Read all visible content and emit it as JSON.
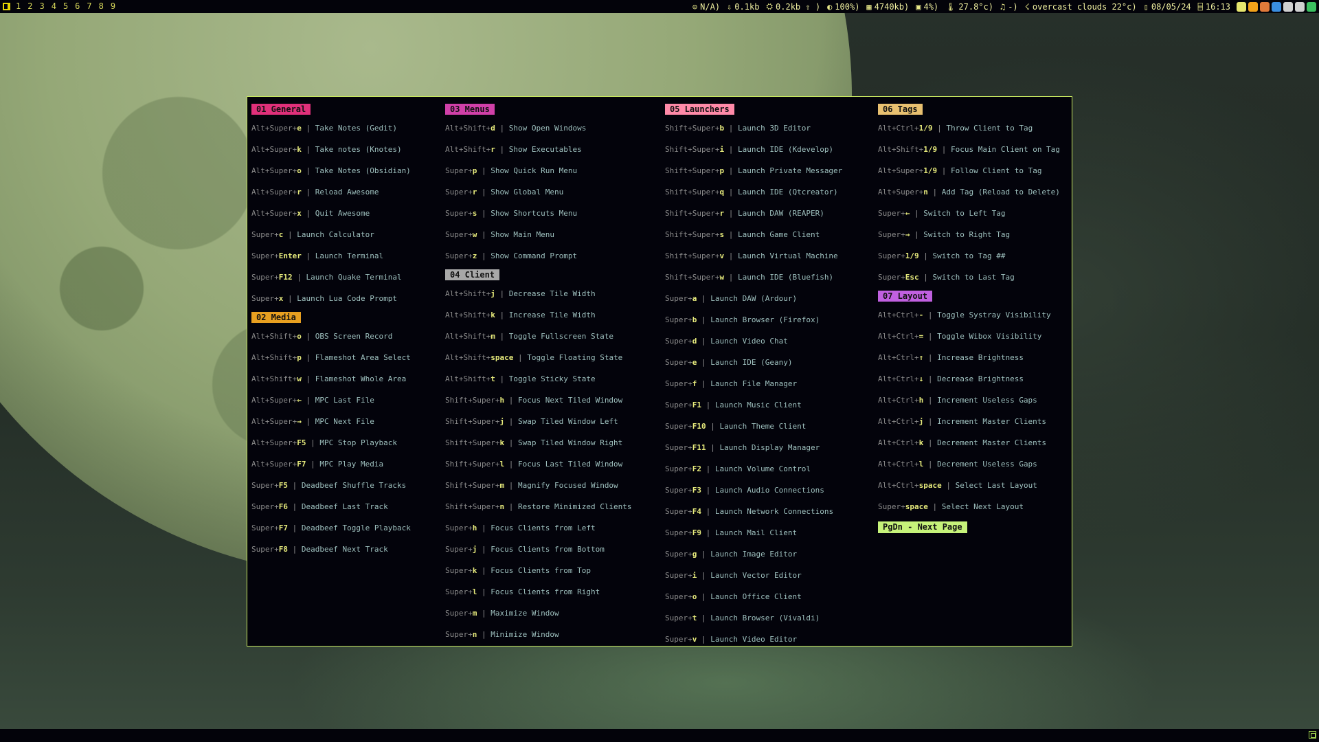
{
  "colors": {
    "bar_bg": "#03030a",
    "popup_bg": "#03030b",
    "popup_border": "#c8e860",
    "key": "#e6ea7c",
    "modifier": "#8b8b8b",
    "description": "#9ec0be",
    "general": "#e0307a",
    "media": "#e8a020",
    "menus": "#d040a8",
    "client": "#a8a8a8",
    "launchers": "#ff8aa8",
    "tags": "#e8c070",
    "layout": "#c060e0",
    "pgdn": "#c6f37a"
  },
  "topbar": {
    "tags": [
      {
        "label": "1",
        "icon": "terminal-icon"
      },
      {
        "label": "2",
        "icon": "browser-icon"
      },
      {
        "label": "3",
        "icon": "code-icon"
      },
      {
        "label": "4",
        "icon": "chat-icon"
      },
      {
        "label": "5",
        "icon": "music-icon"
      },
      {
        "label": "6",
        "icon": "folder-icon"
      },
      {
        "label": "7",
        "icon": "game-icon"
      },
      {
        "label": "8",
        "icon": "media-icon"
      },
      {
        "label": "9",
        "icon": "mail-icon"
      }
    ],
    "status": [
      {
        "icon": "vpn-icon",
        "glyph": "⊙",
        "text": "N/A)"
      },
      {
        "icon": "download-icon",
        "glyph": "⇩",
        "text": "0.1kb"
      },
      {
        "icon": "network-icon",
        "glyph": "⛭",
        "text": "0.2kb ⇧ )"
      },
      {
        "icon": "volume-icon",
        "glyph": "◐",
        "text": "100%)"
      },
      {
        "icon": "memory-icon",
        "glyph": "▦",
        "text": "4740kb)"
      },
      {
        "icon": "cpu-icon",
        "glyph": "▣",
        "text": "4%)"
      },
      {
        "icon": "temperature-icon",
        "glyph": "🌡",
        "text": "27.8°c)"
      },
      {
        "icon": "music-note-icon",
        "glyph": "♫",
        "text": "-)"
      },
      {
        "icon": "weather-icon",
        "glyph": "☇",
        "text": "overcast clouds 22°c)"
      },
      {
        "icon": "calendar-icon",
        "glyph": "▯",
        "text": "08/05/24"
      },
      {
        "icon": "clock-icon",
        "glyph": "⌸",
        "text": "16:13"
      }
    ],
    "tray": [
      {
        "icon": "tray-power-icon",
        "color": "#e6e66e"
      },
      {
        "icon": "tray-notes-icon",
        "color": "#f2a21a"
      },
      {
        "icon": "tray-app-icon",
        "color": "#e07a3a"
      },
      {
        "icon": "tray-telegram-icon",
        "color": "#3a8ee0"
      },
      {
        "icon": "tray-signal-icon",
        "color": "#d0d0d0"
      },
      {
        "icon": "tray-volume-icon",
        "color": "#d0d0d0"
      },
      {
        "icon": "tray-shield-icon",
        "color": "#3cc060"
      }
    ]
  },
  "popup": {
    "columns": [
      {
        "sections": [
          {
            "title": "01 General",
            "color": "#e0307a",
            "rows": [
              {
                "mod": "Alt+Super+",
                "key": "e",
                "desc": "Take Notes (Gedit)"
              },
              {
                "mod": "Alt+Super+",
                "key": "k",
                "desc": "Take notes (Knotes)"
              },
              {
                "mod": "Alt+Super+",
                "key": "o",
                "desc": "Take Notes (Obsidian)"
              },
              {
                "mod": "Alt+Super+",
                "key": "r",
                "desc": "Reload Awesome"
              },
              {
                "mod": "Alt+Super+",
                "key": "x",
                "desc": "Quit Awesome"
              },
              {
                "mod": "Super+",
                "key": "c",
                "desc": "Launch Calculator"
              },
              {
                "mod": "Super+",
                "key": "Enter",
                "desc": "Launch Terminal"
              },
              {
                "mod": "Super+",
                "key": "F12",
                "desc": "Launch Quake Terminal"
              },
              {
                "mod": "Super+",
                "key": "x",
                "desc": "Launch Lua Code Prompt"
              }
            ]
          },
          {
            "title": "02 Media",
            "color": "#e8a020",
            "rows": [
              {
                "mod": "Alt+Shift+",
                "key": "o",
                "desc": "OBS Screen Record"
              },
              {
                "mod": "Alt+Shift+",
                "key": "p",
                "desc": "Flameshot Area Select"
              },
              {
                "mod": "Alt+Shift+",
                "key": "w",
                "desc": "Flameshot Whole Area"
              },
              {
                "mod": "Alt+Super+",
                "key": "←",
                "desc": "MPC Last File"
              },
              {
                "mod": "Alt+Super+",
                "key": "→",
                "desc": "MPC Next File"
              },
              {
                "mod": "Alt+Super+",
                "key": "F5",
                "desc": "MPC Stop Playback"
              },
              {
                "mod": "Alt+Super+",
                "key": "F7",
                "desc": "MPC Play Media"
              },
              {
                "mod": "Super+",
                "key": "F5",
                "desc": "Deadbeef Shuffle Tracks"
              },
              {
                "mod": "Super+",
                "key": "F6",
                "desc": "Deadbeef Last Track"
              },
              {
                "mod": "Super+",
                "key": "F7",
                "desc": "Deadbeef Toggle Playback"
              },
              {
                "mod": "Super+",
                "key": "F8",
                "desc": "Deadbeef Next Track"
              }
            ]
          }
        ]
      },
      {
        "sections": [
          {
            "title": "03 Menus",
            "color": "#d040a8",
            "rows": [
              {
                "mod": "Alt+Shift+",
                "key": "d",
                "desc": "Show Open Windows"
              },
              {
                "mod": "Alt+Shift+",
                "key": "r",
                "desc": "Show Executables"
              },
              {
                "mod": "Super+",
                "key": "p",
                "desc": "Show Quick Run Menu"
              },
              {
                "mod": "Super+",
                "key": "r",
                "desc": "Show Global Menu"
              },
              {
                "mod": "Super+",
                "key": "s",
                "desc": "Show Shortcuts Menu"
              },
              {
                "mod": "Super+",
                "key": "w",
                "desc": "Show Main Menu"
              },
              {
                "mod": "Super+",
                "key": "z",
                "desc": "Show Command Prompt"
              }
            ]
          },
          {
            "title": "04 Client",
            "color": "#a8a8a8",
            "rows": [
              {
                "mod": "Alt+Shift+",
                "key": "j",
                "desc": "Decrease Tile Width"
              },
              {
                "mod": "Alt+Shift+",
                "key": "k",
                "desc": "Increase Tile Width"
              },
              {
                "mod": "Alt+Shift+",
                "key": "m",
                "desc": "Toggle Fullscreen State"
              },
              {
                "mod": "Alt+Shift+",
                "key": "space",
                "desc": "Toggle Floating State"
              },
              {
                "mod": "Alt+Shift+",
                "key": "t",
                "desc": "Toggle Sticky State"
              },
              {
                "mod": "Shift+Super+",
                "key": "h",
                "desc": "Focus Next Tiled Window"
              },
              {
                "mod": "Shift+Super+",
                "key": "j",
                "desc": "Swap Tiled Window Left"
              },
              {
                "mod": "Shift+Super+",
                "key": "k",
                "desc": "Swap Tiled Window Right"
              },
              {
                "mod": "Shift+Super+",
                "key": "l",
                "desc": "Focus Last Tiled Window"
              },
              {
                "mod": "Shift+Super+",
                "key": "m",
                "desc": "Magnify Focused Window"
              },
              {
                "mod": "Shift+Super+",
                "key": "n",
                "desc": "Restore Minimized Clients"
              },
              {
                "mod": "Super+",
                "key": "h",
                "desc": "Focus Clients from Left"
              },
              {
                "mod": "Super+",
                "key": "j",
                "desc": "Focus Clients from Bottom"
              },
              {
                "mod": "Super+",
                "key": "k",
                "desc": "Focus Clients from Top"
              },
              {
                "mod": "Super+",
                "key": "l",
                "desc": "Focus Clients from Right"
              },
              {
                "mod": "Super+",
                "key": "m",
                "desc": "Maximize Window"
              },
              {
                "mod": "Super+",
                "key": "n",
                "desc": "Minimize Window"
              }
            ]
          }
        ]
      },
      {
        "sections": [
          {
            "title": "05 Launchers",
            "color": "#ff8aa8",
            "rows": [
              {
                "mod": "Shift+Super+",
                "key": "b",
                "desc": "Launch 3D Editor"
              },
              {
                "mod": "Shift+Super+",
                "key": "i",
                "desc": "Launch IDE (Kdevelop)"
              },
              {
                "mod": "Shift+Super+",
                "key": "p",
                "desc": "Launch Private Messager"
              },
              {
                "mod": "Shift+Super+",
                "key": "q",
                "desc": "Launch IDE (Qtcreator)"
              },
              {
                "mod": "Shift+Super+",
                "key": "r",
                "desc": "Launch DAW (REAPER)"
              },
              {
                "mod": "Shift+Super+",
                "key": "s",
                "desc": "Launch Game Client"
              },
              {
                "mod": "Shift+Super+",
                "key": "v",
                "desc": "Launch Virtual Machine"
              },
              {
                "mod": "Shift+Super+",
                "key": "w",
                "desc": "Launch IDE (Bluefish)"
              },
              {
                "mod": "Super+",
                "key": "a",
                "desc": "Launch DAW (Ardour)"
              },
              {
                "mod": "Super+",
                "key": "b",
                "desc": "Launch Browser (Firefox)"
              },
              {
                "mod": "Super+",
                "key": "d",
                "desc": "Launch Video Chat"
              },
              {
                "mod": "Super+",
                "key": "e",
                "desc": "Launch IDE (Geany)"
              },
              {
                "mod": "Super+",
                "key": "f",
                "desc": "Launch File Manager"
              },
              {
                "mod": "Super+",
                "key": "F1",
                "desc": "Launch Music Client"
              },
              {
                "mod": "Super+",
                "key": "F10",
                "desc": "Launch Theme Client"
              },
              {
                "mod": "Super+",
                "key": "F11",
                "desc": "Launch Display Manager"
              },
              {
                "mod": "Super+",
                "key": "F2",
                "desc": "Launch Volume Control"
              },
              {
                "mod": "Super+",
                "key": "F3",
                "desc": "Launch Audio Connections"
              },
              {
                "mod": "Super+",
                "key": "F4",
                "desc": "Launch Network Connections"
              },
              {
                "mod": "Super+",
                "key": "F9",
                "desc": "Launch Mail Client"
              },
              {
                "mod": "Super+",
                "key": "g",
                "desc": "Launch Image Editor"
              },
              {
                "mod": "Super+",
                "key": "i",
                "desc": "Launch Vector Editor"
              },
              {
                "mod": "Super+",
                "key": "o",
                "desc": "Launch Office Client"
              },
              {
                "mod": "Super+",
                "key": "t",
                "desc": "Launch Browser (Vivaldi)"
              },
              {
                "mod": "Super+",
                "key": "v",
                "desc": "Launch Video Editor"
              }
            ]
          }
        ]
      },
      {
        "sections": [
          {
            "title": "06 Tags",
            "color": "#e8c070",
            "rows": [
              {
                "mod": "Alt+Ctrl+",
                "key": "1/9",
                "desc": "Throw Client to Tag"
              },
              {
                "mod": "Alt+Shift+",
                "key": "1/9",
                "desc": "Focus Main Client on Tag"
              },
              {
                "mod": "Alt+Super+",
                "key": "1/9",
                "desc": "Follow Client to Tag"
              },
              {
                "mod": "Alt+Super+",
                "key": "n",
                "desc": "Add Tag (Reload to Delete)"
              },
              {
                "mod": "Super+",
                "key": "←",
                "desc": "Switch to Left Tag"
              },
              {
                "mod": "Super+",
                "key": "→",
                "desc": "Switch to Right Tag"
              },
              {
                "mod": "Super+",
                "key": "1/9",
                "desc": "Switch to Tag ##"
              },
              {
                "mod": "Super+",
                "key": "Esc",
                "desc": "Switch to Last Tag"
              }
            ]
          },
          {
            "title": "07 Layout",
            "color": "#c060e0",
            "rows": [
              {
                "mod": "Alt+Ctrl+",
                "key": "-",
                "desc": "Toggle Systray Visibility"
              },
              {
                "mod": "Alt+Ctrl+",
                "key": "=",
                "desc": "Toggle Wibox Visibility"
              },
              {
                "mod": "Alt+Ctrl+",
                "key": "↑",
                "desc": "Increase Brightness"
              },
              {
                "mod": "Alt+Ctrl+",
                "key": "↓",
                "desc": "Decrease Brightness"
              },
              {
                "mod": "Alt+Ctrl+",
                "key": "h",
                "desc": "Increment Useless Gaps"
              },
              {
                "mod": "Alt+Ctrl+",
                "key": "j",
                "desc": "Increment Master Clients"
              },
              {
                "mod": "Alt+Ctrl+",
                "key": "k",
                "desc": "Decrement Master Clients"
              },
              {
                "mod": "Alt+Ctrl+",
                "key": "l",
                "desc": "Decrement Useless Gaps"
              },
              {
                "mod": "Alt+Ctrl+",
                "key": "space",
                "desc": "Select Last Layout"
              },
              {
                "mod": "Super+",
                "key": "space",
                "desc": "Select Next Layout"
              }
            ]
          }
        ],
        "footer": "PgDn - Next Page"
      }
    ]
  }
}
